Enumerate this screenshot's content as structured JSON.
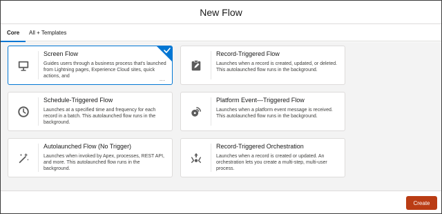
{
  "modal": {
    "title": "New Flow"
  },
  "tabs": [
    {
      "label": "Core",
      "active": true
    },
    {
      "label": "All + Templates",
      "active": false
    }
  ],
  "cards": [
    {
      "title": "Screen Flow",
      "description": "Guides users through a business process that's launched from Lightning pages, Experience Cloud sites, quick actions, and",
      "icon": "monitor-icon",
      "selected": true,
      "truncated_marker": "..."
    },
    {
      "title": "Record-Triggered Flow",
      "description": "Launches when a record is created, updated, or deleted. This autolaunched flow runs in the background.",
      "icon": "record-edit-icon",
      "selected": false
    },
    {
      "title": "Schedule-Triggered Flow",
      "description": "Launches at a specified time and frequency for each record in a batch. This autolaunched flow runs in the background.",
      "icon": "clock-icon",
      "selected": false
    },
    {
      "title": "Platform Event—Triggered Flow",
      "description": "Launches when a platform event message is received. This autolaunched flow runs in the background.",
      "icon": "platform-event-icon",
      "selected": false
    },
    {
      "title": "Autolaunched Flow (No Trigger)",
      "description": "Launches when invoked by Apex, processes, REST API, and more. This autolaunched flow runs in the background.",
      "icon": "magic-wand-icon",
      "selected": false
    },
    {
      "title": "Record-Triggered Orchestration",
      "description": "Launches when a record is created or updated. An orchestration lets you create a multi-step, multi-user process.",
      "icon": "orchestration-icon",
      "selected": false
    }
  ],
  "footer": {
    "create_label": "Create"
  },
  "colors": {
    "accent": "#0176d3",
    "create_button": "#ba3c14",
    "icon_gray": "#5c5c5c"
  }
}
